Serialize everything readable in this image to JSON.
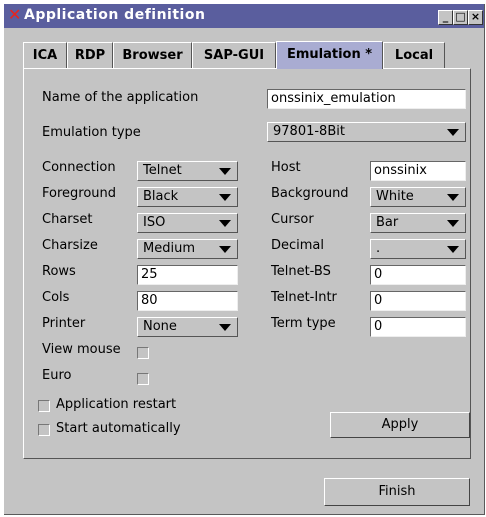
{
  "window": {
    "title": "Application definition",
    "minimize_label": "_",
    "maximize_label": "□",
    "close_label": "×"
  },
  "tabs": [
    {
      "label": "ICA"
    },
    {
      "label": "RDP"
    },
    {
      "label": "Browser"
    },
    {
      "label": "SAP-GUI"
    },
    {
      "label": "Emulation *",
      "active": true
    },
    {
      "label": "Local"
    }
  ],
  "form": {
    "app_name_label": "Name of the application",
    "app_name_value": "onssinix_emulation",
    "emulation_type_label": "Emulation type",
    "emulation_type_value": "97801-8Bit",
    "left": {
      "connection": {
        "label": "Connection",
        "value": "Telnet"
      },
      "foreground": {
        "label": "Foreground",
        "value": "Black"
      },
      "charset": {
        "label": "Charset",
        "value": "ISO"
      },
      "charsize": {
        "label": "Charsize",
        "value": "Medium"
      },
      "rows": {
        "label": "Rows",
        "value": "25"
      },
      "cols": {
        "label": "Cols",
        "value": "80"
      },
      "printer": {
        "label": "Printer",
        "value": "None"
      },
      "view_mouse": {
        "label": "View mouse"
      },
      "euro": {
        "label": "Euro"
      }
    },
    "right": {
      "host": {
        "label": "Host",
        "value": "onssinix"
      },
      "background": {
        "label": "Background",
        "value": "White"
      },
      "cursor": {
        "label": "Cursor",
        "value": "Bar"
      },
      "decimal": {
        "label": "Decimal",
        "value": "."
      },
      "telnet_bs": {
        "label": "Telnet-BS",
        "value": "0"
      },
      "telnet_intr": {
        "label": "Telnet-Intr",
        "value": "0"
      },
      "term_type": {
        "label": "Term type",
        "value": "0"
      }
    },
    "application_restart_label": "Application restart",
    "start_automatically_label": "Start automatically",
    "apply_label": "Apply"
  },
  "footer": {
    "finish_label": "Finish"
  },
  "colors": {
    "titlebar": "#5a5e9e",
    "active_tab": "#a9acd2",
    "window_bg": "#c4c4c4",
    "close_x": "#e8241c"
  }
}
